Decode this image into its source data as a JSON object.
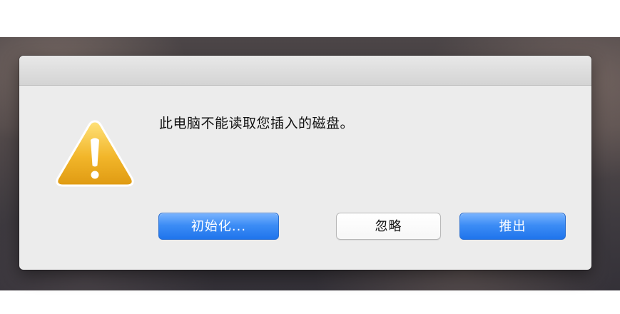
{
  "alert": {
    "message": "此电脑不能读取您插入的磁盘。",
    "icon": "warning-icon",
    "buttons": {
      "initialize": "初始化...",
      "ignore": "忽略",
      "eject": "推出"
    }
  },
  "colors": {
    "primary_button": "#2f83f1",
    "dialog_background": "#ececec",
    "warning_yellow": "#f2b62a"
  }
}
